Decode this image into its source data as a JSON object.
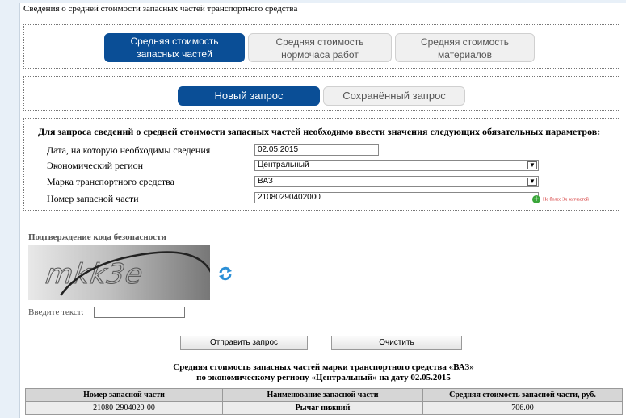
{
  "page_title": "Сведения о средней стоимости запасных частей транспортного средства",
  "category_tabs": [
    {
      "line1": "Средняя стоимость",
      "line2": "запасных частей",
      "active": true
    },
    {
      "line1": "Средняя стоимость",
      "line2": "нормочаса работ",
      "active": false
    },
    {
      "line1": "Средняя стоимость",
      "line2": "материалов",
      "active": false
    }
  ],
  "request_tabs": {
    "new": "Новый запрос",
    "saved": "Сохранённый запрос"
  },
  "form": {
    "heading": "Для запроса сведений о средней стоимости запасных частей необходимо ввести значения следующих обязательных параметров:",
    "date_label": "Дата, на которую необходимы сведения",
    "date_value": "02.05.2015",
    "region_label": "Экономический регион",
    "region_value": "Центральный",
    "brand_label": "Марка транспортного средства",
    "brand_value": "ВАЗ",
    "part_label": "Номер запасной части",
    "part_value": "21080290402000",
    "add_part_note": "Не более 3х запчастей"
  },
  "captcha": {
    "heading": "Подтверждение кода безопасности",
    "code_text": "mkk3e",
    "input_label": "Введите текст:",
    "input_value": ""
  },
  "buttons": {
    "submit": "Отправить запрос",
    "clear": "Очистить"
  },
  "result": {
    "title_line1": "Средняя стоимость запасных частей марки транспортного средства «ВАЗ»",
    "title_line2": "по экономическому региону «Центральный» на дату 02.05.2015",
    "columns": [
      "Номер запасной части",
      "Наименование запасной части",
      "Средняя стоимость запасной части, руб."
    ],
    "rows": [
      [
        "21080-2904020-00",
        "Рычаг нижний",
        "706.00"
      ]
    ]
  },
  "colors": {
    "accent": "#0a4e96",
    "add_icon": "#3aa63a",
    "note_text": "#d02020",
    "refresh_icon": "#2b8fd6"
  }
}
